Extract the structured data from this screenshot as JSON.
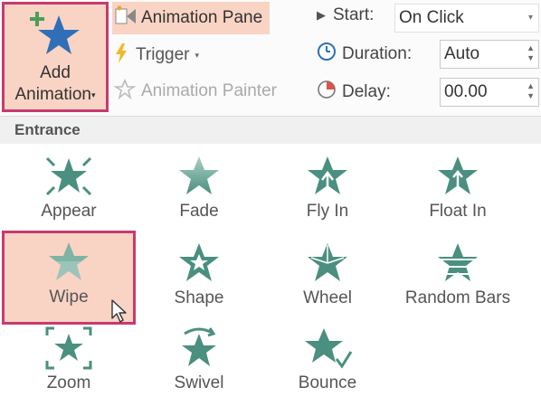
{
  "colors": {
    "accent_fill": "#f9d4c4",
    "accent_border": "#c83a6f",
    "star_teal": "#4a8f7f",
    "star_blue": "#2f6fb8"
  },
  "ribbon": {
    "add_animation": {
      "label_line1": "Add",
      "label_line2": "Animation",
      "icon": "star-with-plus-icon"
    },
    "advanced": {
      "animation_pane_label": "Animation Pane",
      "trigger_label": "Trigger",
      "animation_painter_label": "Animation Painter"
    },
    "timing": {
      "start_label": "Start:",
      "start_value": "On Click",
      "duration_label": "Duration:",
      "duration_value": "Auto",
      "delay_label": "Delay:",
      "delay_value": "00.00"
    }
  },
  "gallery": {
    "section_title": "Entrance",
    "effects": [
      {
        "name": "Appear",
        "icon": "appear-star-icon"
      },
      {
        "name": "Fade",
        "icon": "fade-star-icon"
      },
      {
        "name": "Fly In",
        "icon": "fly-in-star-icon"
      },
      {
        "name": "Float In",
        "icon": "float-in-star-icon"
      },
      {
        "name": "Wipe",
        "icon": "wipe-star-icon",
        "selected": true
      },
      {
        "name": "Shape",
        "icon": "shape-star-icon"
      },
      {
        "name": "Wheel",
        "icon": "wheel-star-icon"
      },
      {
        "name": "Random Bars",
        "icon": "random-bars-star-icon"
      },
      {
        "name": "Zoom",
        "icon": "zoom-star-icon"
      },
      {
        "name": "Swivel",
        "icon": "swivel-star-icon"
      },
      {
        "name": "Bounce",
        "icon": "bounce-star-icon"
      }
    ]
  }
}
